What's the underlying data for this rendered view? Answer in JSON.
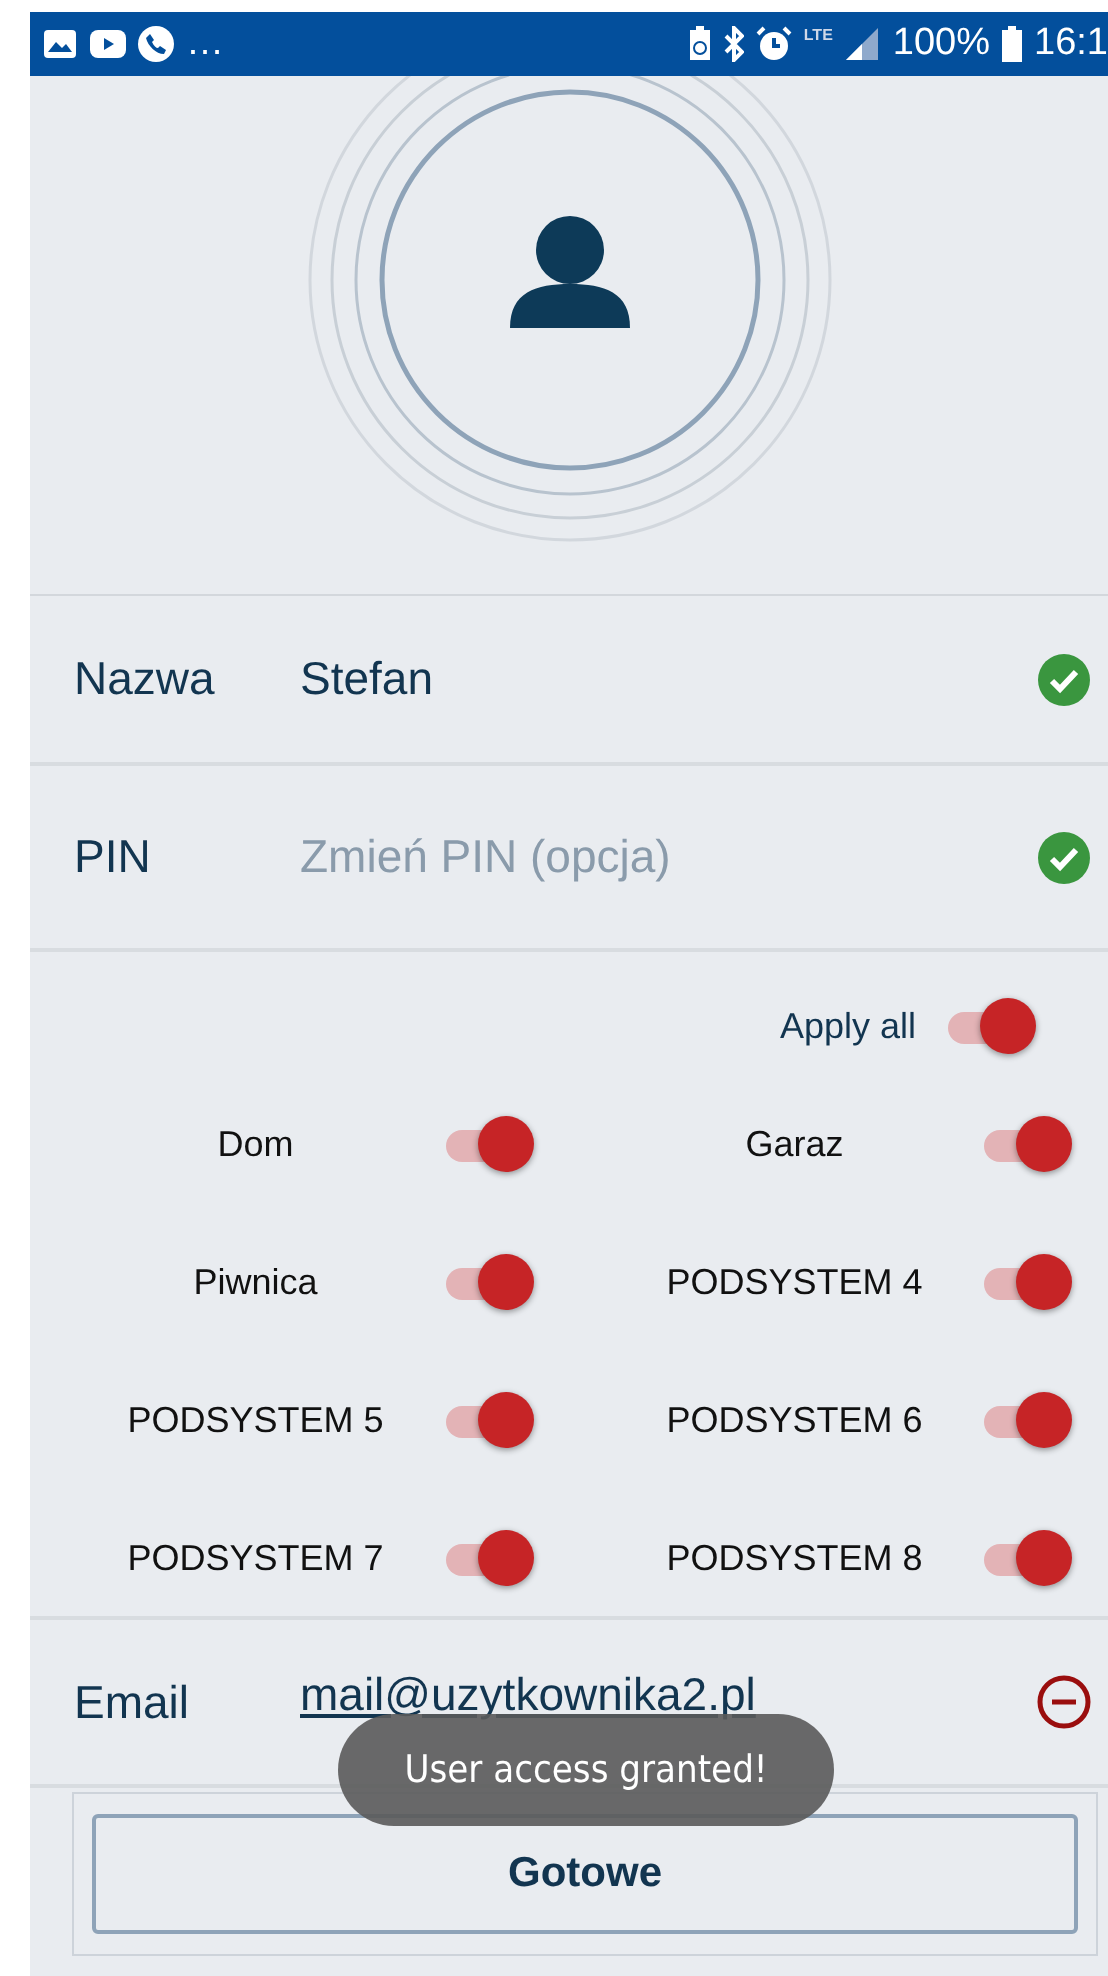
{
  "status_bar": {
    "overflow": "…",
    "network": "LTE",
    "battery": "100%",
    "time": "16:1"
  },
  "fields": [
    {
      "label": "Nazwa",
      "value": "Stefan",
      "valid": true
    },
    {
      "label": "PIN",
      "placeholder": "Zmień PIN (opcja)",
      "valid": true
    }
  ],
  "apply_all": {
    "label": "Apply all",
    "on": true
  },
  "switches": [
    {
      "label": "Dom",
      "on": true
    },
    {
      "label": "Garaz",
      "on": true
    },
    {
      "label": "Piwnica",
      "on": true
    },
    {
      "label": "PODSYSTEM 4",
      "on": true
    },
    {
      "label": "PODSYSTEM 5",
      "on": true
    },
    {
      "label": "PODSYSTEM 6",
      "on": true
    },
    {
      "label": "PODSYSTEM 7",
      "on": true
    },
    {
      "label": "PODSYSTEM 8",
      "on": true
    }
  ],
  "email": {
    "label": "Email",
    "value": "mail@uzytkownika2.pl"
  },
  "toast": "User access granted!",
  "done_button": "Gotowe"
}
